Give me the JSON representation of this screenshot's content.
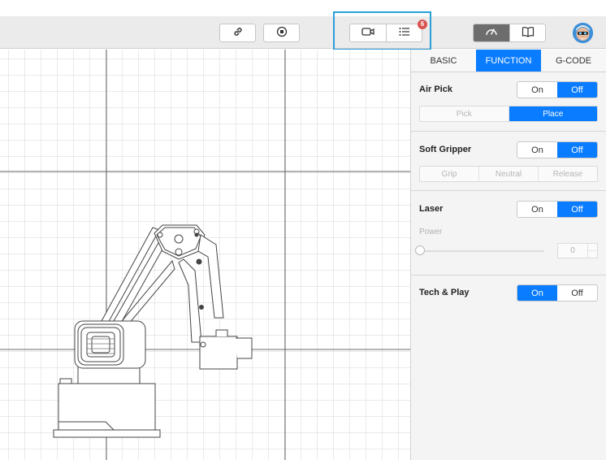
{
  "toolbar": {
    "link_icon": "link-icon",
    "stop_icon": "record-stop-icon",
    "camera_icon": "camera-icon",
    "list_icon": "list-icon",
    "notification_count": "6",
    "speed_icon": "speedometer-icon",
    "book_icon": "book-icon",
    "avatar_icon": "avatar"
  },
  "panel": {
    "tabs": [
      {
        "label": "BASIC",
        "active": false
      },
      {
        "label": "FUNCTION",
        "active": true
      },
      {
        "label": "G-CODE",
        "active": false
      }
    ],
    "air_pick": {
      "title": "Air Pick",
      "on_label": "On",
      "off_label": "Off",
      "selected": "Off",
      "modes": [
        "Pick",
        "Place"
      ],
      "selected_mode": "Place"
    },
    "soft_gripper": {
      "title": "Soft Gripper",
      "on_label": "On",
      "off_label": "Off",
      "selected": "Off",
      "modes": [
        "Grip",
        "Neutral",
        "Release"
      ]
    },
    "laser": {
      "title": "Laser",
      "on_label": "On",
      "off_label": "Off",
      "selected": "Off",
      "power_label": "Power",
      "power_value": "0",
      "power_fraction": 0
    },
    "tech_play": {
      "title": "Tech & Play",
      "on_label": "On",
      "off_label": "Off",
      "selected": "On"
    }
  },
  "colors": {
    "accent": "#0a7cff",
    "highlight_box": "#2a9fd8",
    "badge": "#d9534f"
  }
}
